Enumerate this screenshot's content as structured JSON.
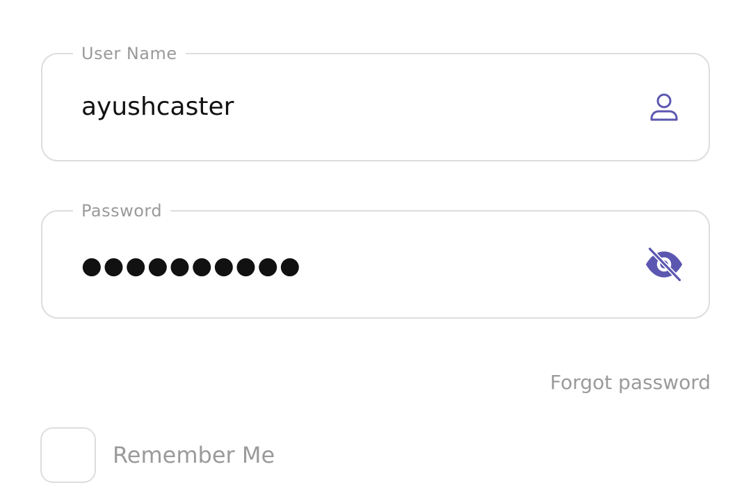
{
  "username": {
    "label": "User Name",
    "value": "ayushcaster",
    "icon": "user-icon"
  },
  "password": {
    "label": "Password",
    "value_masked": "●●●●●●●●●●",
    "icon": "eye-off-icon"
  },
  "forgot_password": {
    "label": "Forgot password"
  },
  "remember_me": {
    "label": "Remember Me",
    "checked": false
  },
  "colors": {
    "accent": "#5b57b0",
    "border": "#dddddd",
    "muted_text": "#9a9a9a",
    "value_text": "#111111"
  }
}
